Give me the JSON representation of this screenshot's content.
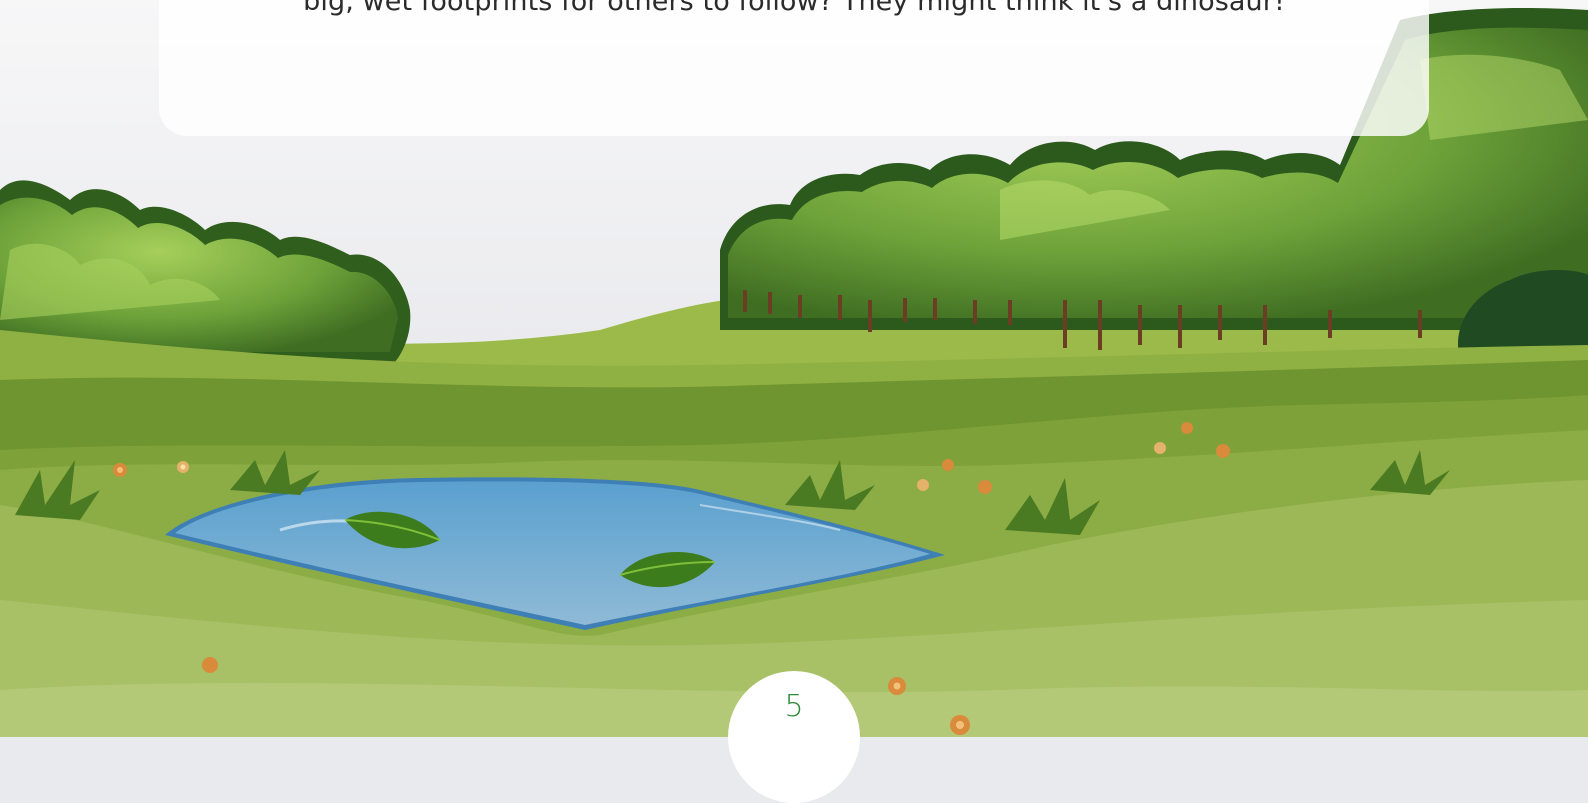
{
  "story": {
    "text": "big, wet footprints for others to follow? They might think it's a dinosaur!"
  },
  "page": {
    "number": "5"
  }
}
